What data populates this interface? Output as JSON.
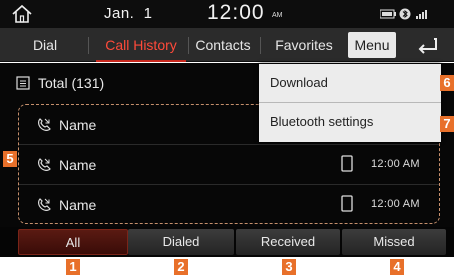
{
  "status": {
    "date": "Jan.  1",
    "time": "12:00",
    "ampm": "AM"
  },
  "tabs": [
    {
      "label": "Dial",
      "active": false
    },
    {
      "label": "Call History",
      "active": true
    },
    {
      "label": "Contacts",
      "active": false
    },
    {
      "label": "Favorites",
      "active": false
    }
  ],
  "menu_label": "Menu",
  "total_label": "Total (131)",
  "calls": [
    {
      "name": "Name",
      "time": "",
      "show_phone": false
    },
    {
      "name": "Name",
      "time": "12:00 AM",
      "show_phone": true
    },
    {
      "name": "Name",
      "time": "12:00 AM",
      "show_phone": true
    }
  ],
  "dropdown": {
    "items": [
      "Download",
      "Bluetooth settings"
    ]
  },
  "filters": [
    {
      "label": "All",
      "active": true
    },
    {
      "label": "Dialed",
      "active": false
    },
    {
      "label": "Received",
      "active": false
    },
    {
      "label": "Missed",
      "active": false
    }
  ],
  "callouts": [
    "1",
    "2",
    "3",
    "4",
    "5",
    "6",
    "7"
  ],
  "colors": {
    "accent": "#ff4a3a",
    "callout": "#e8702a",
    "list_border": "#c58f6c"
  }
}
